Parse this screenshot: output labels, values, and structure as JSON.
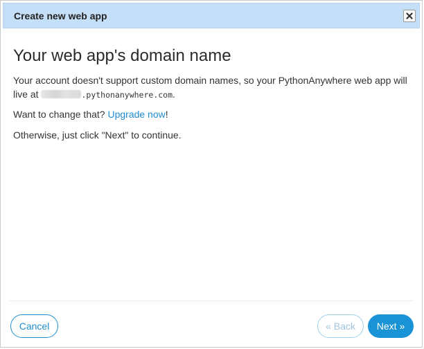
{
  "dialog": {
    "title": "Create new web app",
    "close_icon": "close-icon"
  },
  "content": {
    "heading": "Your web app's domain name",
    "line1": "Your account doesn't support custom domain names, so your PythonAnywhere web app will live at ",
    "domain_suffix": ".pythonanywhere.com",
    "line1_end": ".",
    "line2_prefix": "Want to change that? ",
    "upgrade_link": "Upgrade now",
    "line2_end": "!",
    "line3": "Otherwise, just click \"Next\" to continue."
  },
  "footer": {
    "cancel_label": "Cancel",
    "back_label": "« Back",
    "next_label": "Next »"
  },
  "colors": {
    "titlebar_bg": "#c6dff8",
    "accent": "#1a93d6",
    "link": "#1d8cd0"
  }
}
